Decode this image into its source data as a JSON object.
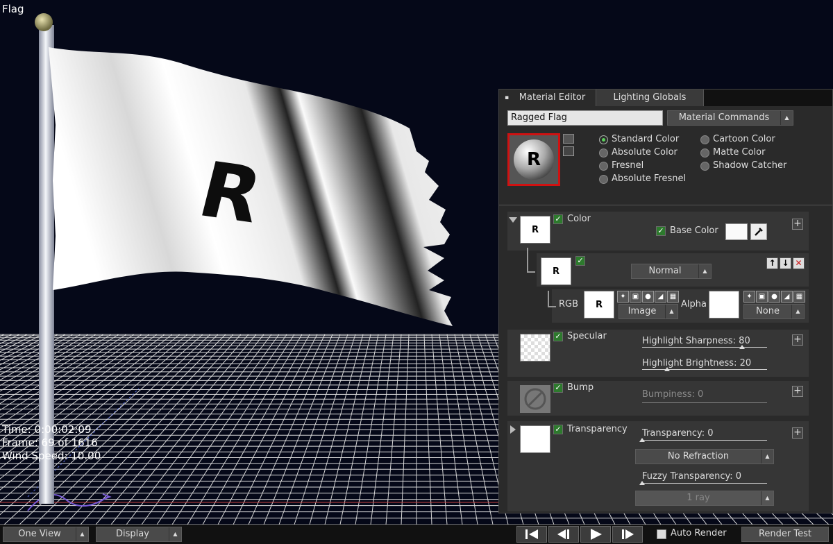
{
  "viewport": {
    "title": "Flag",
    "hud": {
      "time": "Time: 0:00:02:09",
      "frame": "Frame: 69  of  1616",
      "wind": "Wind Speed: 10.00"
    },
    "flag_letter": "R"
  },
  "bottombar": {
    "view_select": "One View",
    "display_select": "Display",
    "transport": [
      "skip-to-start-icon",
      "step-back-icon",
      "play-icon",
      "step-forward-icon"
    ],
    "auto_render_label": "Auto Render",
    "auto_render_checked": false,
    "render_test_label": "Render Test"
  },
  "panel": {
    "tabs": [
      "Material Editor",
      "Lighting Globals"
    ],
    "material_name": "Ragged Flag",
    "material_commands": "Material Commands",
    "preview_letter": "R",
    "radios_left": [
      "Standard Color",
      "Absolute Color",
      "Fresnel",
      "Absolute Fresnel"
    ],
    "radios_right": [
      "Cartoon Color",
      "Matte Color",
      "Shadow Catcher"
    ],
    "selected_radio": "Standard Color",
    "color": {
      "label": "Color",
      "thumb_letter": "R",
      "base_color_label": "Base Color",
      "layer_thumb_letter": "R",
      "blend_mode": "Normal",
      "rgb_label": "RGB",
      "rgb_thumb_letter": "R",
      "rgb_source": "Image",
      "alpha_label": "Alpha",
      "alpha_source": "None"
    },
    "specular": {
      "label": "Specular",
      "sharpness_label": "Highlight Sharpness: 80",
      "sharpness_value": 80,
      "brightness_label": "Highlight Brightness: 20",
      "brightness_value": 20
    },
    "bump": {
      "label": "Bump",
      "bumpiness_label": "Bumpiness: 0",
      "bumpiness_value": 0
    },
    "transparency": {
      "label": "Transparency",
      "transparency_label": "Transparency: 0",
      "transparency_value": 0,
      "refraction": "No Refraction",
      "fuzzy_label": "Fuzzy Transparency: 0",
      "fuzzy_value": 0,
      "rays": "1 ray"
    }
  },
  "colors": {
    "viewport_bg": "#050818",
    "grid": "#d8d8d8",
    "panel_bg": "#2a2a2a",
    "check_green": "#2d7a2d",
    "accent_red": "#cc1111"
  }
}
